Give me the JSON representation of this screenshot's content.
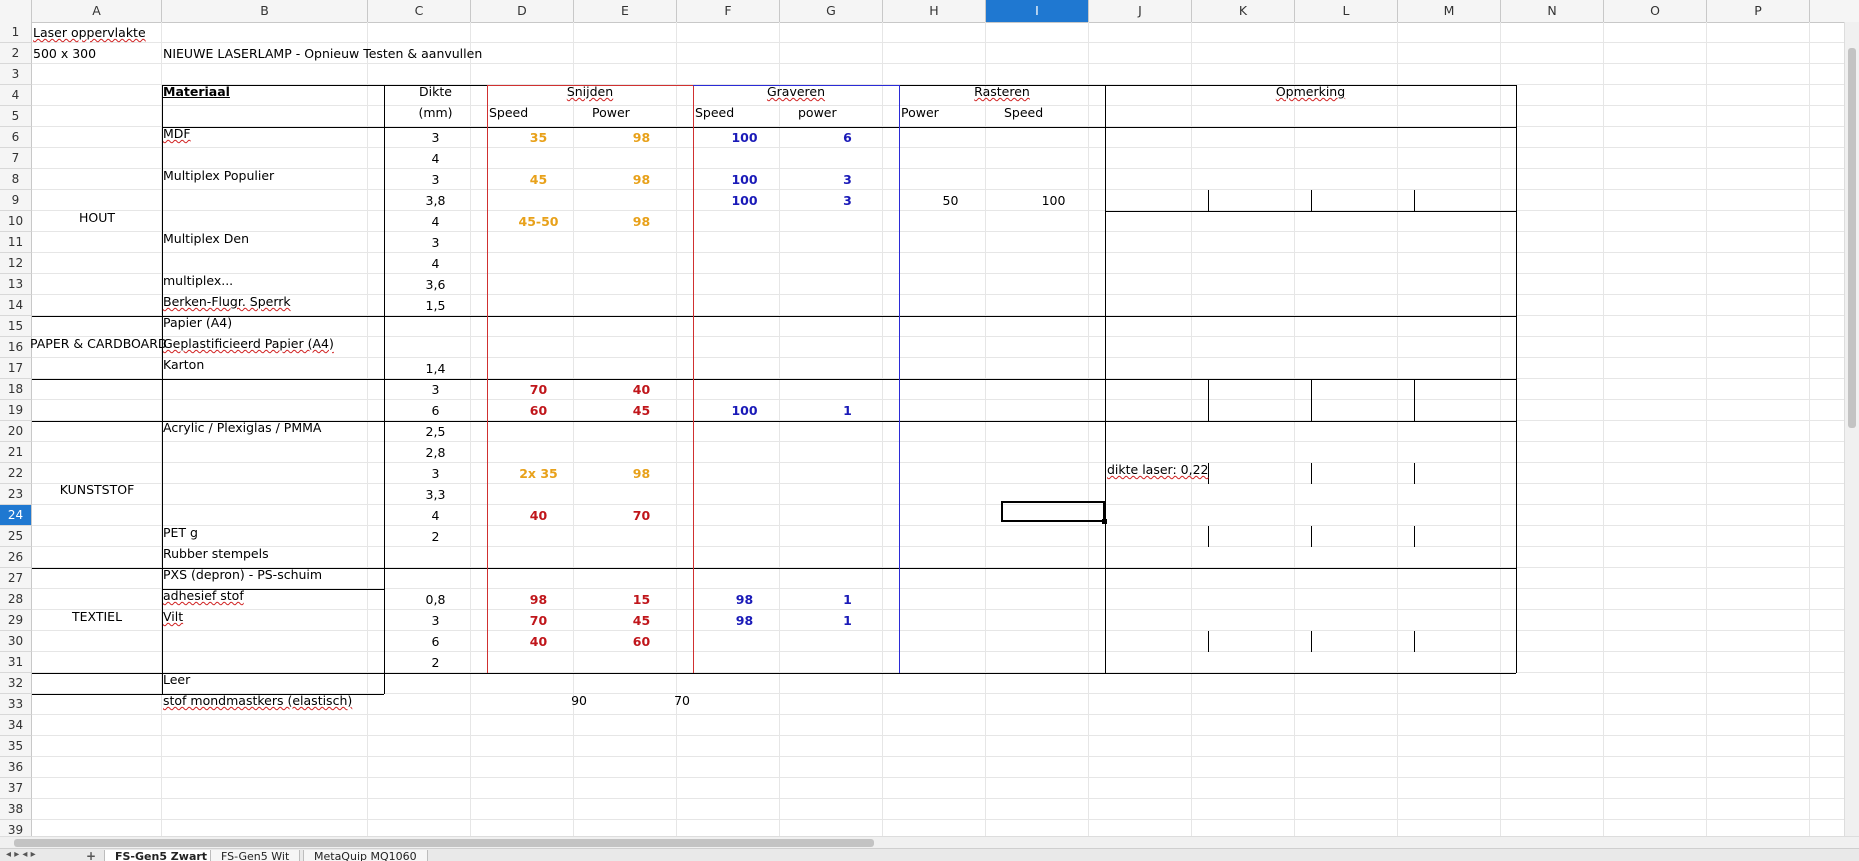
{
  "columns": [
    "A",
    "B",
    "C",
    "D",
    "E",
    "F",
    "G",
    "H",
    "I",
    "J",
    "K",
    "L",
    "M",
    "N",
    "O",
    "P"
  ],
  "selected_column": "I",
  "selected_row": "24",
  "rows": [
    "1",
    "2",
    "3",
    "4",
    "5",
    "6",
    "7",
    "8",
    "9",
    "10",
    "11",
    "12",
    "13",
    "14",
    "15",
    "16",
    "17",
    "18",
    "19",
    "20",
    "21",
    "22",
    "23",
    "24",
    "25",
    "26",
    "27",
    "28",
    "29",
    "30",
    "31",
    "32",
    "33",
    "34",
    "35",
    "36",
    "37",
    "38",
    "39"
  ],
  "header": {
    "laser_surface_label": "Laser oppervlakte",
    "laser_surface_value": "500 x 300",
    "sheet_title": "NIEUWE LASERLAMP - Opnieuw Testen & aanvullen",
    "materiaal": "Materiaal",
    "dikte": "Dikte",
    "dikte_unit": "(mm)",
    "snijden": "Snijden",
    "graveren": "Graveren",
    "rasteren": "Rasteren",
    "opmerking": "Opmerking",
    "speed": "Speed",
    "power": "Power",
    "power_lower": "power"
  },
  "categories": {
    "hout": "HOUT",
    "papier": "PAPER & CARDBOARD",
    "kunststof": "KUNSTSTOF",
    "textiel": "TEXTIEL"
  },
  "materials": {
    "mdf": "MDF",
    "multiplex_populier": "Multiplex Populier",
    "multiplex_den": "Multiplex Den",
    "multiplex_dots": "multiplex...",
    "berken": "Berken-Flugr. Sperrk",
    "papier_a4": "Papier (A4)",
    "geplast": "Geplastificieerd Papier (A4)",
    "karton": "Karton",
    "acrylic": "Acrylic / Plexiglas / PMMA",
    "pet": "PET g",
    "rubber": "Rubber stempels",
    "pxs": "PXS (depron) - PS-schuim",
    "adhesief": "adhesief stof",
    "vilt": "Vilt",
    "leer": "Leer",
    "mondmasker": "stof mondmastkers (elastisch)"
  },
  "thickness": {
    "r6": "3",
    "r7": "4",
    "r8": "3",
    "r9": "3,8",
    "r10": "4",
    "r11": "3",
    "r12": "4",
    "r13": "3,6",
    "r14": "1,5",
    "r17": "1,4",
    "r18": "3",
    "r19": "6",
    "r20": "2,5",
    "r21": "2,8",
    "r22": "3",
    "r23": "3,3",
    "r24": "4",
    "r25": "2",
    "r28": "0,8",
    "r29": "3",
    "r30": "6",
    "r31": "2"
  },
  "cut_speed": {
    "r6": "35",
    "r8": "45",
    "r10": "45-50",
    "r18": "70",
    "r19": "60",
    "r22": "2x 35",
    "r24": "40",
    "r28": "98",
    "r29": "70",
    "r30": "40"
  },
  "cut_power": {
    "r6": "98",
    "r8": "98",
    "r10": "98",
    "r18": "40",
    "r19": "45",
    "r22": "98",
    "r24": "70",
    "r28": "15",
    "r29": "45",
    "r30": "60"
  },
  "engrave_speed": {
    "r6": "100",
    "r8": "100",
    "r9": "100",
    "r19": "100",
    "r28": "98",
    "r29": "98"
  },
  "engrave_power": {
    "r6": "6",
    "r8": "3",
    "r9": "3",
    "r19": "1",
    "r28": "1",
    "r29": "1"
  },
  "raster": {
    "r9_power": "50",
    "r9_speed": "100"
  },
  "remark_r22": "dikte laser: 0,22",
  "mondmasker_d": "90",
  "mondmasker_e": "70",
  "sheet_tabs": [
    "FS-Gen5 Zwart",
    "FS-Gen5 Wit",
    "MetaQuip MQ1060"
  ],
  "active_tab": "FS-Gen5 Zwart",
  "colors": {
    "orange": "#e8a11a",
    "red": "#c0161b",
    "blue": "#1a1ab8",
    "selection": "#1f78d1"
  }
}
